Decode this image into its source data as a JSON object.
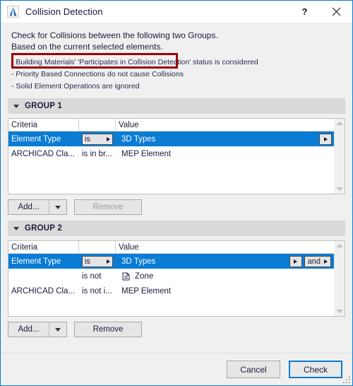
{
  "window": {
    "title": "Collision Detection",
    "icon": "archicad-app-icon",
    "help_label": "?",
    "close_label": "✕"
  },
  "intro": {
    "line1": "Check for Collisions between the following two Groups.",
    "line2": "Based on the current selected elements.",
    "highlight_color": "#9c0000",
    "bullets": [
      "- Building Materials' 'Participates in Collision Detection' status is considered",
      "- Priority Based Connections do not cause Collisions",
      "- Solid Element Operations are ignored"
    ]
  },
  "columns": {
    "criteria": "Criteria",
    "operator": "",
    "value": "Value"
  },
  "groups": [
    {
      "title": "GROUP 1",
      "rows": [
        {
          "criteria": "Element Type",
          "operator": "is",
          "value": "3D Types",
          "selected": true,
          "operator_is_dropdown": true,
          "has_value_arrow": true,
          "has_and_button": false,
          "and_label": "",
          "icon": ""
        },
        {
          "criteria": "ARCHICAD Cla...",
          "operator": "is in br...",
          "value": "MEP Element",
          "selected": false,
          "operator_is_dropdown": false,
          "has_value_arrow": false,
          "has_and_button": false,
          "and_label": "",
          "icon": ""
        }
      ],
      "add_label": "Add...",
      "remove_label": "Remove",
      "remove_enabled": false
    },
    {
      "title": "GROUP 2",
      "rows": [
        {
          "criteria": "Element Type",
          "operator": "is",
          "value": "3D Types",
          "selected": true,
          "operator_is_dropdown": true,
          "has_value_arrow": true,
          "has_and_button": true,
          "and_label": "and",
          "icon": ""
        },
        {
          "criteria": "",
          "operator": "is not",
          "value": "Zone",
          "selected": false,
          "operator_is_dropdown": false,
          "has_value_arrow": false,
          "has_and_button": false,
          "and_label": "",
          "icon": "zone-icon"
        },
        {
          "criteria": "ARCHICAD Cla...",
          "operator": "is not i...",
          "value": "MEP Element",
          "selected": false,
          "operator_is_dropdown": false,
          "has_value_arrow": false,
          "has_and_button": false,
          "and_label": "",
          "icon": ""
        }
      ],
      "add_label": "Add...",
      "remove_label": "Remove",
      "remove_enabled": true
    }
  ],
  "footer": {
    "cancel_label": "Cancel",
    "check_label": "Check",
    "accent_color": "#0a7cd4"
  }
}
